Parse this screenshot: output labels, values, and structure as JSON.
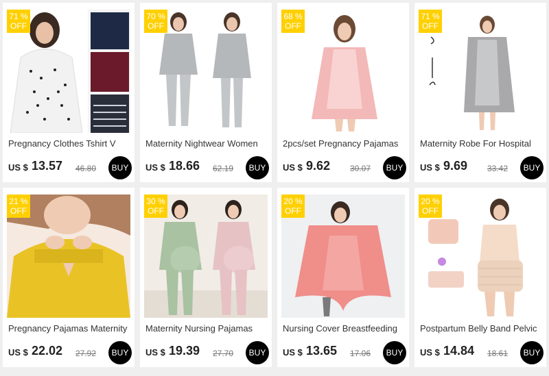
{
  "colors": {
    "badge": "#ffd000",
    "buy_button": "#000000",
    "price": "#222222",
    "old_price": "#777777"
  },
  "products": [
    {
      "discount": "71 %",
      "off": "OFF",
      "title": "Pregnancy Clothes Tshirt V",
      "currency": "US $",
      "price": "13.57",
      "old_price": "46.80",
      "buy": "BUY",
      "image": "woman-maternity-tshirt-photo"
    },
    {
      "discount": "70 %",
      "off": "OFF",
      "title": "Maternity Nightwear Women",
      "currency": "US $",
      "price": "18.66",
      "old_price": "62.19",
      "buy": "BUY",
      "image": "grey-nightwear-set-photo"
    },
    {
      "discount": "68 %",
      "off": "OFF",
      "title": "2pcs/set Pregnancy Pajamas",
      "currency": "US $",
      "price": "9.62",
      "old_price": "30.07",
      "buy": "BUY",
      "image": "pink-robe-set-photo"
    },
    {
      "discount": "71 %",
      "off": "OFF",
      "title": "Maternity Robe For Hospital",
      "currency": "US $",
      "price": "9.69",
      "old_price": "33.42",
      "buy": "BUY",
      "image": "grey-robe-photo"
    },
    {
      "discount": "21 %",
      "off": "OFF",
      "title": "Pregnancy Pajamas Maternity",
      "currency": "US $",
      "price": "22.02",
      "old_price": "27.92",
      "buy": "BUY",
      "image": "yellow-nursing-top-photo"
    },
    {
      "discount": "30 %",
      "off": "OFF",
      "title": "Maternity Nursing Pajamas",
      "currency": "US $",
      "price": "19.39",
      "old_price": "27.70",
      "buy": "BUY",
      "image": "green-pink-pajamas-photo"
    },
    {
      "discount": "20 %",
      "off": "OFF",
      "title": "Nursing Cover Breastfeeding",
      "currency": "US $",
      "price": "13.65",
      "old_price": "17.06",
      "buy": "BUY",
      "image": "pink-nursing-cover-photo"
    },
    {
      "discount": "20 %",
      "off": "OFF",
      "title": "Postpartum Belly Band Pelvic",
      "currency": "US $",
      "price": "14.84",
      "old_price": "18.61",
      "buy": "BUY",
      "image": "belly-band-photo"
    }
  ]
}
